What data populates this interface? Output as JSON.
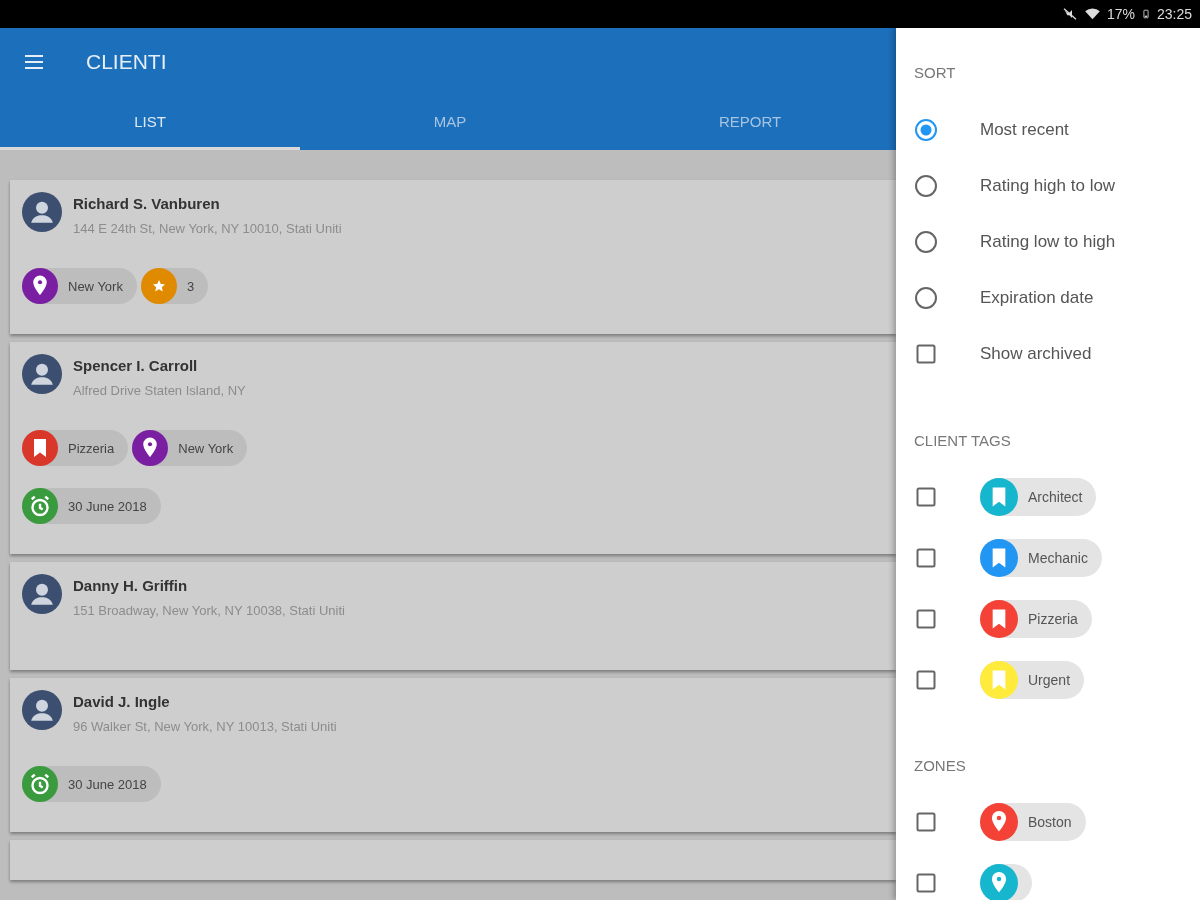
{
  "status_bar": {
    "battery": "17%",
    "time": "23:25"
  },
  "header": {
    "title": "CLIENTI"
  },
  "tabs": [
    {
      "label": "LIST",
      "selected": true
    },
    {
      "label": "MAP",
      "selected": false
    },
    {
      "label": "REPORT",
      "selected": false
    }
  ],
  "cards": [
    {
      "name": "Richard S. Vanburen",
      "address": "144 E 24th St, New York, NY 10010, Stati Uniti",
      "chips": [
        {
          "kind": "zone",
          "label": "New York",
          "color": "#7b1fa2"
        },
        {
          "kind": "rating",
          "label": "3",
          "color": "#e08a00"
        }
      ]
    },
    {
      "name": "Spencer I. Carroll",
      "address": "Alfred Drive Staten Island, NY",
      "chips": [
        {
          "kind": "tag",
          "label": "Pizzeria",
          "color": "#d8372a"
        },
        {
          "kind": "zone",
          "label": "New York",
          "color": "#7b1fa2"
        },
        {
          "kind": "expiration",
          "label": "30 June 2018",
          "color": "#3a9a3e"
        }
      ]
    },
    {
      "name": "Danny H. Griffin",
      "address": "151 Broadway, New York, NY 10038, Stati Uniti"
    },
    {
      "name": "David J. Ingle",
      "address": "96 Walker St, New York, NY 10013, Stati Uniti",
      "chips": [
        {
          "kind": "expiration",
          "label": "30 June 2018",
          "color": "#3a9a3e"
        }
      ]
    }
  ],
  "drawer": {
    "sort_title": "SORT",
    "sort": [
      {
        "label": "Most recent",
        "selected": true
      },
      {
        "label": "Rating high to low",
        "selected": false
      },
      {
        "label": "Rating low to high",
        "selected": false
      },
      {
        "label": "Expiration date",
        "selected": false
      }
    ],
    "show_archived": {
      "label": "Show archived",
      "checked": false
    },
    "tags_title": "CLIENT TAGS",
    "tags": [
      {
        "label": "Architect",
        "color": "#17b6cf",
        "checked": false
      },
      {
        "label": "Mechanic",
        "color": "#2196f3",
        "checked": false
      },
      {
        "label": "Pizzeria",
        "color": "#f44336",
        "checked": false
      },
      {
        "label": "Urgent",
        "color": "#ffeb3b",
        "checked": false
      }
    ],
    "zones_title": "ZONES",
    "zones": [
      {
        "label": "Boston",
        "color": "#f44336",
        "checked": false
      },
      {
        "color": "#17b6cf",
        "checked": false
      }
    ]
  }
}
